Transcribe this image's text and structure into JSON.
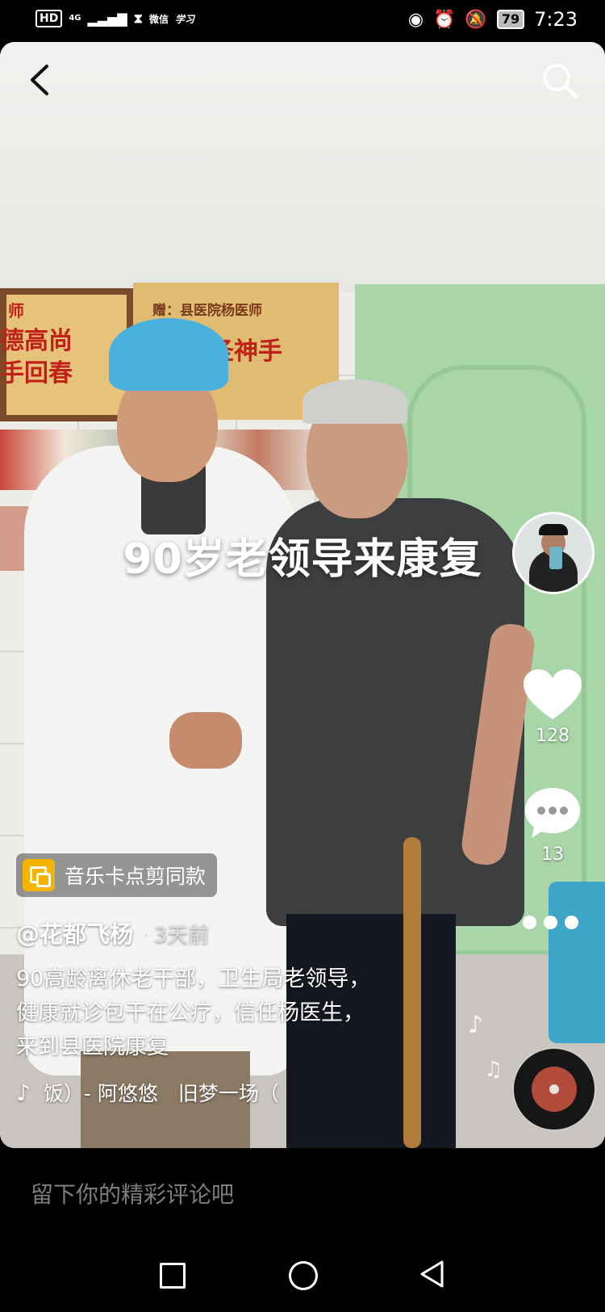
{
  "status_bar": {
    "left_items": [
      "HD",
      "4G",
      "⧗",
      "微信",
      "学习"
    ],
    "battery": "79",
    "time": "7:23"
  },
  "video": {
    "caption": "90岁老领导来康复",
    "plaques": [
      "师",
      "德高尚",
      "手回春",
      "赠：县医院杨医师",
      "圣神手"
    ]
  },
  "actions": {
    "likes": "128",
    "comments": "13"
  },
  "template_chip": {
    "label": "音乐卡点剪同款"
  },
  "post": {
    "author": "@花都飞杨",
    "separator": "·",
    "time_ago": "3天前",
    "description_lines": [
      "90高龄离休老干部，卫生局老领导，",
      "健康就诊包干在公疗，信任杨医生，",
      "来到县医院康复"
    ]
  },
  "music": {
    "text": "饭）- 阿悠悠　旧梦一场（"
  },
  "comment_bar": {
    "placeholder": "留下你的精彩评论吧"
  },
  "colors": {
    "accent": "#f5b400",
    "background": "#000000"
  },
  "icons": [
    "back-icon",
    "search-icon",
    "heart-icon",
    "comment-icon",
    "more-icon",
    "music-note-icon",
    "tiktok-icon"
  ]
}
